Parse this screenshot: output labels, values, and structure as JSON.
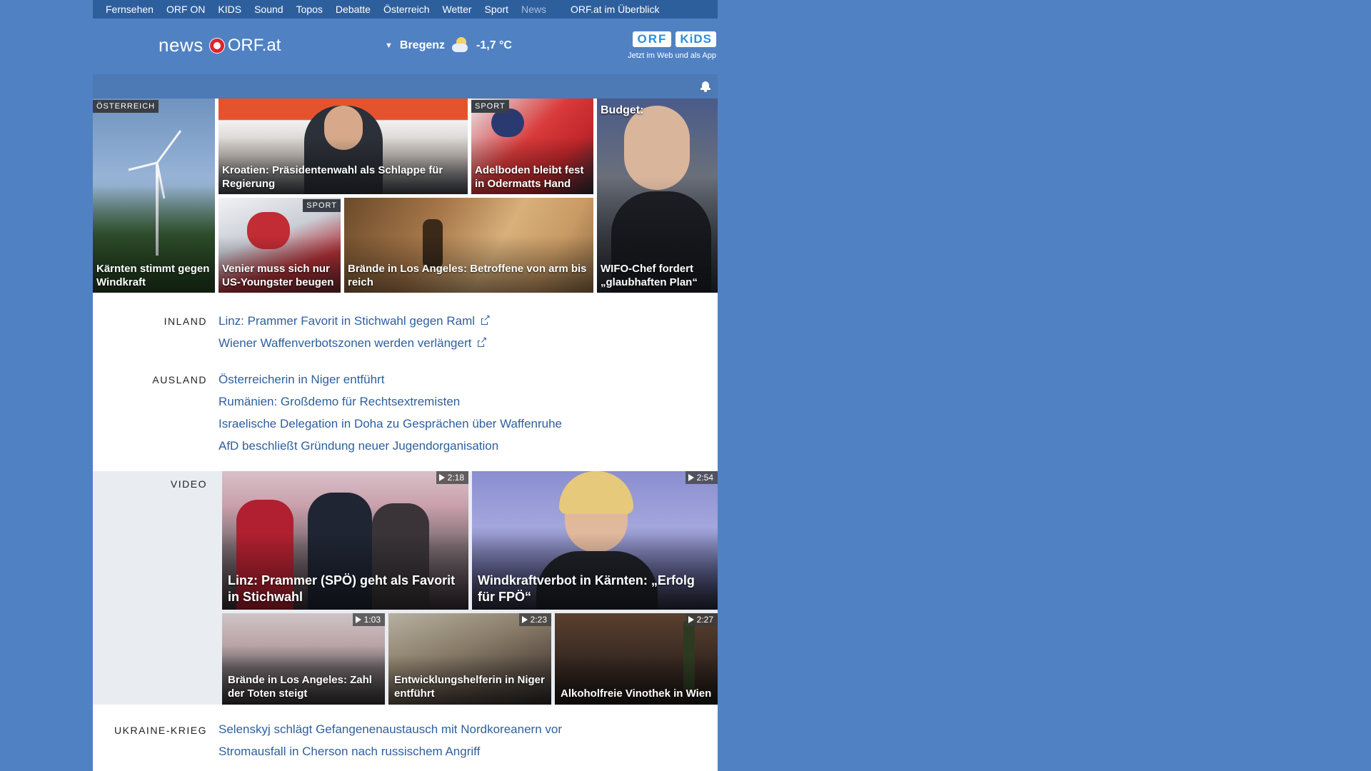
{
  "topnav": {
    "items": [
      "Fernsehen",
      "ORF ON",
      "KIDS",
      "Sound",
      "Topos",
      "Debatte",
      "Österreich",
      "Wetter",
      "Sport",
      "News"
    ],
    "active": "News",
    "overview": "ORF.at im Überblick"
  },
  "header": {
    "logo_news": "news",
    "logo_orf": "ORF.at",
    "weather": {
      "city": "Bregenz",
      "temp": "-1,7 °C",
      "icon": "moon-cloud-icon"
    },
    "kids": {
      "badge_orf": "ORF",
      "badge_kids": "KiDS",
      "subtitle": "Jetzt im Web und als App"
    }
  },
  "tiles": [
    {
      "category": "ÖSTERREICH",
      "caption": "Kärnten stimmt gegen Windkraft"
    },
    {
      "category": "",
      "caption": "Kroatien: Präsidentenwahl als Schlappe für Regierung"
    },
    {
      "category": "SPORT",
      "caption": "Adelboden bleibt fest in Odermatts Hand"
    },
    {
      "category": "",
      "title": "Budget:",
      "caption": "WIFO-Chef fordert „glaubhaften Plan“"
    },
    {
      "category": "SPORT",
      "caption": "Venier muss sich nur US-Youngster beugen"
    },
    {
      "category": "",
      "caption": "Brände in Los Angeles: Betroffene von arm bis reich"
    }
  ],
  "inland": {
    "label": "INLAND",
    "links": [
      "Linz: Prammer Favorit in Stichwahl gegen Raml",
      "Wiener Waffenverbotszonen werden verlängert"
    ]
  },
  "ausland": {
    "label": "AUSLAND",
    "links": [
      "Österreicherin in Niger entführt",
      "Rumänien: Großdemo für Rechtsextremisten",
      "Israelische Delegation in Doha zu Gesprächen über Waffenruhe",
      "AfD beschließt Gründung neuer Jugendorganisation"
    ]
  },
  "video": {
    "label": "VIDEO",
    "items": [
      {
        "duration": "2:18",
        "caption": "Linz: Prammer (SPÖ) geht als Favorit in Stichwahl"
      },
      {
        "duration": "2:54",
        "caption": "Windkraftverbot in Kärnten: „Erfolg für FPÖ“"
      },
      {
        "duration": "1:03",
        "caption": "Brände in Los Angeles: Zahl der Toten steigt"
      },
      {
        "duration": "2:23",
        "caption": "Entwicklungshelferin in Niger entführt"
      },
      {
        "duration": "2:27",
        "caption": "Alkoholfreie Vinothek in Wien"
      }
    ]
  },
  "ukraine": {
    "label": "UKRAINE-KRIEG",
    "links": [
      "Selenskyj schlägt Gefangenenaustausch mit Nordkoreanern vor",
      "Stromausfall in Cherson nach russischem Angriff"
    ]
  },
  "colors": {
    "background": "#5082c3",
    "nav": "#2e5f9d",
    "link": "#2e5f9d",
    "brand_red": "#e0232b"
  }
}
